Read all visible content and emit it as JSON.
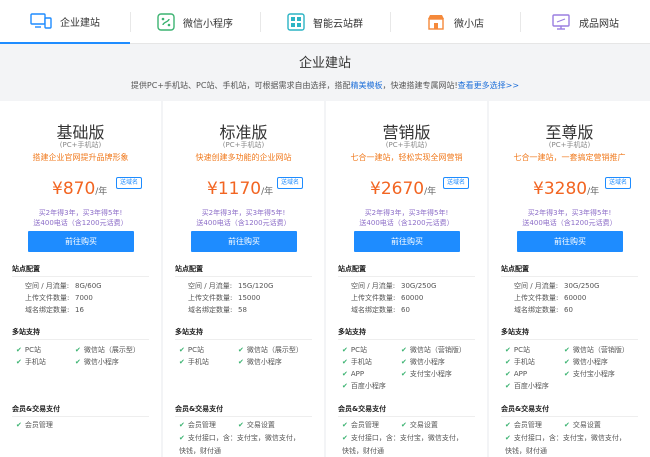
{
  "tabs": [
    {
      "label": "企业建站",
      "icon": "desktop-mobile-icon",
      "active": true
    },
    {
      "label": "微信小程序",
      "icon": "mini-program-icon",
      "active": false
    },
    {
      "label": "智能云站群",
      "icon": "site-cluster-icon",
      "active": false
    },
    {
      "label": "微小店",
      "icon": "shop-icon",
      "active": false
    },
    {
      "label": "成品网站",
      "icon": "monitor-icon",
      "active": false
    }
  ],
  "section": {
    "title": "企业建站",
    "subtitle_pre": "提供PC+手机站、PC站、手机站，可根据需求自由选择，搭配",
    "subtitle_link": "精美模板",
    "subtitle_post": "，快速搭建专属网站!",
    "subtitle_more": "查看更多选择>>"
  },
  "labels": {
    "site_config": "站点配置",
    "space": "空间 / 月流量:",
    "files": "上传文件数量:",
    "domains": "域名绑定数量:",
    "multi_site": "多站支持",
    "member_pay": "会员&交易支付",
    "buy_button": "前往购买",
    "badge": "送域名",
    "price_unit": "/年",
    "check": "✔"
  },
  "plans": [
    {
      "name": "基础版",
      "note": "(PC+手机站)",
      "slogan": "搭建企业官网提升品牌形象",
      "price": "¥870",
      "promo1": "买2年得3年，买3年得5年!",
      "promo2": "送400电话（含1200元话费）",
      "space": "8G/60G",
      "files": "7000",
      "domains": "16",
      "f1": "PC站",
      "f2": "微信站（展示型）",
      "f3": "手机站",
      "f4": "微信小程序",
      "f5": "",
      "f6": "",
      "f7": "",
      "m1": "会员管理",
      "m2": "",
      "m3": "",
      "m4": ""
    },
    {
      "name": "标准版",
      "note": "(PC+手机站)",
      "slogan": "快速创建多功能的企业网站",
      "price": "¥1170",
      "promo1": "买2年得3年，买3年得5年!",
      "promo2": "送400电话（含1200元话费）",
      "space": "15G/120G",
      "files": "15000",
      "domains": "58",
      "f1": "PC站",
      "f2": "微信站（展示型）",
      "f3": "手机站",
      "f4": "微信小程序",
      "f5": "",
      "f6": "",
      "f7": "",
      "m1": "会员管理",
      "m2": "交易设置",
      "m3": "支付接口，含：支付宝，微信支付，",
      "m4": "快钱，财付通"
    },
    {
      "name": "营销版",
      "note": "(PC+手机站)",
      "slogan": "七合一建站，轻松实现全网营销",
      "price": "¥2670",
      "promo1": "买2年得3年，买3年得5年!",
      "promo2": "送400电话（含1200元话费）",
      "space": "30G/250G",
      "files": "60000",
      "domains": "60",
      "f1": "PC站",
      "f2": "微信站（营销版）",
      "f3": "手机站",
      "f4": "微信小程序",
      "f5": "APP",
      "f6": "支付宝小程序",
      "f7": "百度小程序",
      "m1": "会员管理",
      "m2": "交易设置",
      "m3": "支付接口，含：支付宝，微信支付，",
      "m4": "快钱，财付通"
    },
    {
      "name": "至尊版",
      "note": "(PC+手机站)",
      "slogan": "七合一建站，一套搞定营销推广",
      "price": "¥3280",
      "promo1": "买2年得3年，买3年得5年!",
      "promo2": "送400电话（含1200元话费）",
      "space": "30G/250G",
      "files": "60000",
      "domains": "60",
      "f1": "PC站",
      "f2": "微信站（营销版）",
      "f3": "手机站",
      "f4": "微信小程序",
      "f5": "APP",
      "f6": "支付宝小程序",
      "f7": "百度小程序",
      "m1": "会员管理",
      "m2": "交易设置",
      "m3": "支付接口，含：支付宝，微信支付，",
      "m4": "快钱，财付通"
    }
  ],
  "colors": {
    "accent": "#1e8cff",
    "price": "#f26522",
    "slogan": "#f07a1e",
    "promo": "#8d6ec8",
    "check": "#3cb371"
  }
}
